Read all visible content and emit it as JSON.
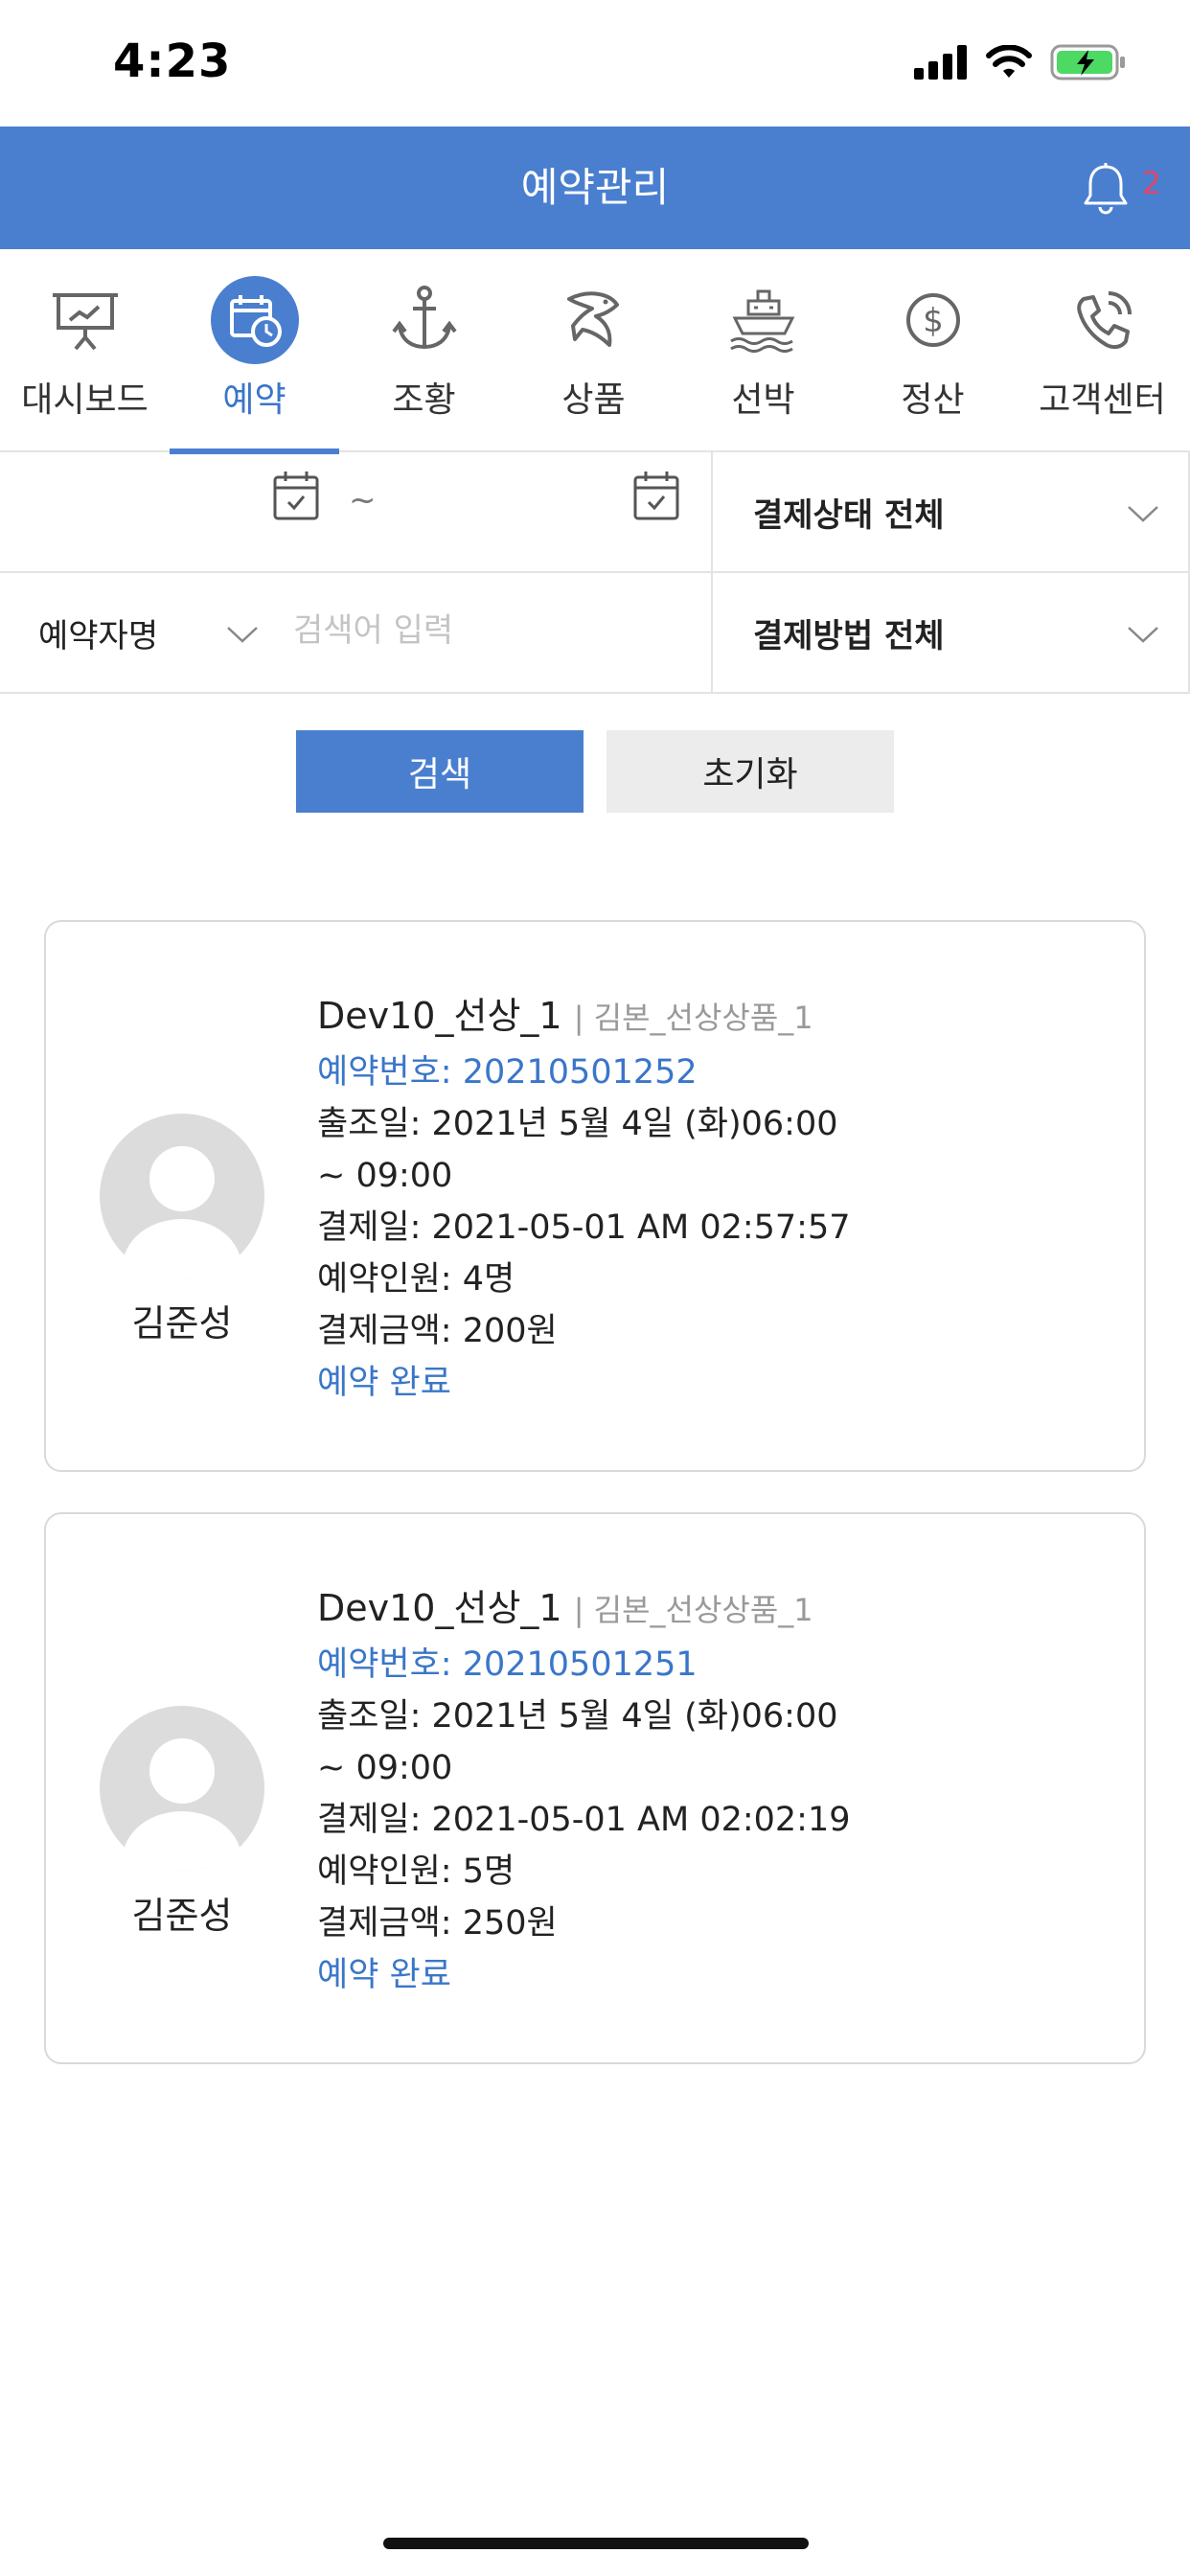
{
  "status_bar": {
    "time": "4:23"
  },
  "header": {
    "title": "예약관리",
    "notification_count": "2"
  },
  "nav": {
    "items": [
      {
        "label": "대시보드",
        "icon": "presentation-board-icon"
      },
      {
        "label": "예약",
        "icon": "calendar-clock-icon",
        "active": true
      },
      {
        "label": "조황",
        "icon": "anchor-icon"
      },
      {
        "label": "상품",
        "icon": "fish-icon"
      },
      {
        "label": "선박",
        "icon": "ship-icon"
      },
      {
        "label": "정산",
        "icon": "dollar-coin-icon"
      },
      {
        "label": "고객센터",
        "icon": "phone-call-icon"
      }
    ]
  },
  "filters": {
    "date_separator": "~",
    "payment_status": "결제상태 전체",
    "name_select": "예약자명",
    "search_placeholder": "검색어 입력",
    "payment_method": "결제방법 전체"
  },
  "buttons": {
    "search": "검색",
    "reset": "초기화"
  },
  "reservations": [
    {
      "customer": "김준성",
      "title": "Dev10_선상_1",
      "subtitle": "| 김본_선상상품_1",
      "number": "예약번호: 20210501252",
      "depart_line1": "출조일: 2021년 5월 4일 (화)06:00",
      "depart_line2": "~ 09:00",
      "paid_at": "결제일: 2021-05-01 AM 02:57:57",
      "people": "예약인원: 4명",
      "amount": "결제금액: 200원",
      "status": "예약 완료"
    },
    {
      "customer": "김준성",
      "title": "Dev10_선상_1",
      "subtitle": "| 김본_선상상품_1",
      "number": "예약번호: 20210501251",
      "depart_line1": "출조일: 2021년 5월 4일 (화)06:00",
      "depart_line2": "~ 09:00",
      "paid_at": "결제일: 2021-05-01 AM 02:02:19",
      "people": "예약인원: 5명",
      "amount": "결제금액: 250원",
      "status": "예약 완료"
    }
  ],
  "colors": {
    "accent": "#4a7fd0",
    "link": "#3a76c9",
    "badge": "#e0456a"
  }
}
